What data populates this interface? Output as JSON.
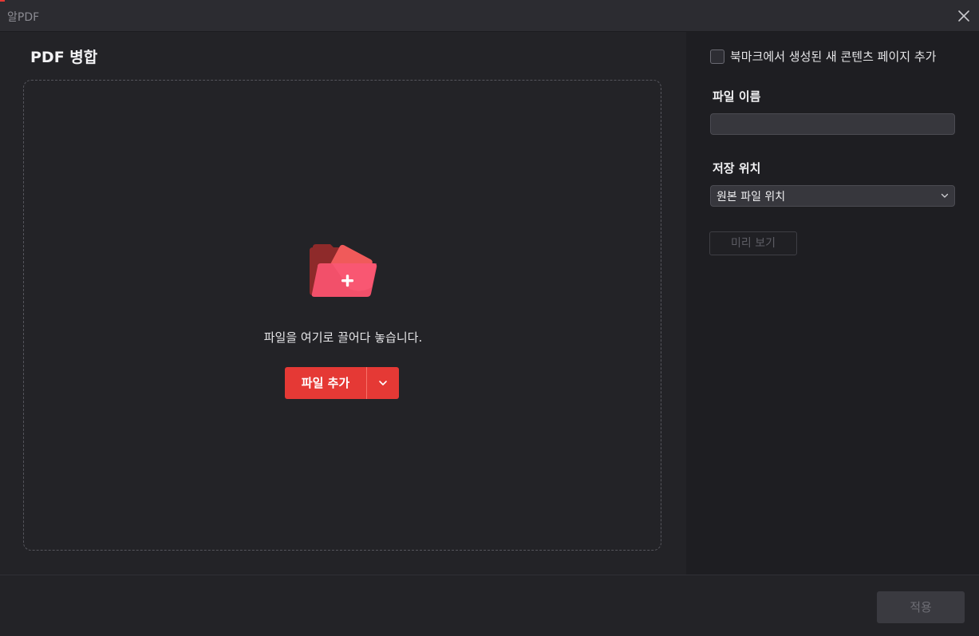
{
  "window": {
    "title": "알PDF",
    "accent_color": "#e53935"
  },
  "merge": {
    "title": "PDF 병합",
    "drop_text": "파일을 여기로 끌어다 놓습니다.",
    "add_file_label": "파일 추가",
    "icons": [
      "folder-add-icon",
      "chevron-down-icon"
    ]
  },
  "options": {
    "bookmark_checkbox_label": "북마크에서 생성된 새 콘텐츠 페이지 추가",
    "bookmark_checked": false,
    "file_name_label": "파일 이름",
    "file_name_value": "",
    "save_location_label": "저장 위치",
    "save_location_value": "원본 파일 위치",
    "preview_label": "미리 보기"
  },
  "footer": {
    "apply_label": "적용"
  }
}
